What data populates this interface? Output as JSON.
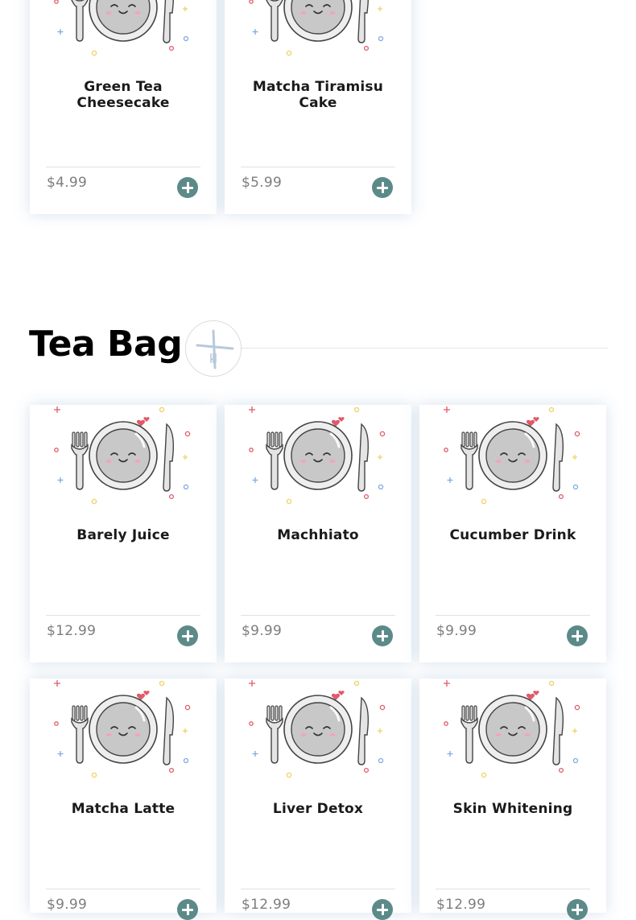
{
  "sections": [
    {
      "title": "",
      "products": [
        {
          "name": "Green Tea Cheesecake",
          "price": "$4.99"
        },
        {
          "name": "Matcha Tiramisu Cake",
          "price": "$5.99"
        }
      ]
    },
    {
      "title": "Tea Bag",
      "products": [
        {
          "name": "Barely Juice",
          "price": "$12.99"
        },
        {
          "name": "Machhiato",
          "price": "$9.99"
        },
        {
          "name": "Cucumber Drink",
          "price": "$9.99"
        },
        {
          "name": "Matcha Latte",
          "price": "$9.99"
        },
        {
          "name": "Liver Detox",
          "price": "$12.99"
        },
        {
          "name": "Skin Whitening",
          "price": "$12.99"
        }
      ]
    }
  ],
  "icons": {
    "product_thumbnail": "plate-with-fork-knife-icon",
    "add_button": "plus-circle-icon",
    "category_badge": "fork-knife-icon"
  },
  "colors": {
    "add_button": "#5c8a89",
    "price_text": "#7d7d7d",
    "card_shadow": "#9ab8d6"
  }
}
